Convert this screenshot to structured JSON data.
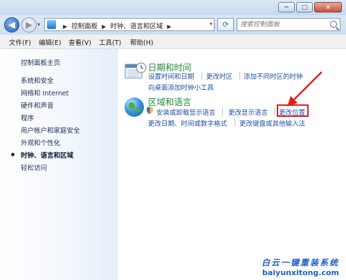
{
  "window": {
    "minimize_glyph": "−",
    "maximize_glyph": "□",
    "close_glyph": "×"
  },
  "nav": {
    "breadcrumbs": [
      "控制面板",
      "时钟、语言和区域"
    ],
    "search_placeholder": "搜索控制面板"
  },
  "menu": [
    "文件(F)",
    "编辑(E)",
    "查看(V)",
    "工具(T)",
    "帮助(H)"
  ],
  "sidebar": {
    "home": "控制面板主页",
    "items": [
      "系统和安全",
      "网络和 Internet",
      "硬件和声音",
      "程序",
      "用户帐户和家庭安全",
      "外观和个性化",
      "时钟、语言和区域",
      "轻松访问"
    ],
    "current_index": 6
  },
  "categories": {
    "datetime": {
      "title": "日期和时间",
      "links": [
        "设置时间和日期",
        "更改时区",
        "添加不同时区的时钟",
        "向桌面添加时钟小工具"
      ]
    },
    "region": {
      "title": "区域和语言",
      "links": [
        "安装或卸载显示语言",
        "更改显示语言",
        "更改位置",
        "更改日期、时间或数字格式",
        "更改键盘或其他输入法"
      ]
    }
  },
  "annotation": {
    "highlight_color": "#e01b1b"
  },
  "watermark": {
    "title": "白云一键重装系统",
    "url": "baiyunxitong.com"
  }
}
